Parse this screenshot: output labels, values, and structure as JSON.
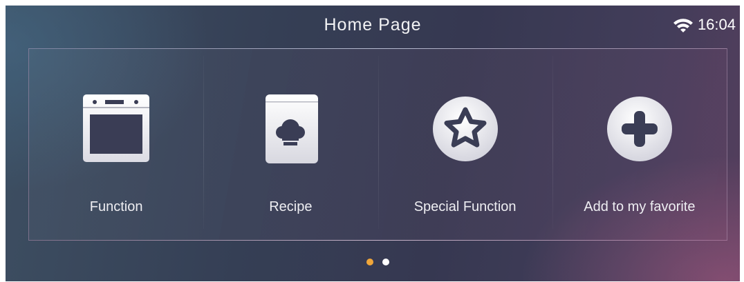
{
  "header": {
    "title": "Home Page",
    "time": "16:04",
    "wifi_icon": "wifi-icon"
  },
  "menu": {
    "items": [
      {
        "label": "Function",
        "icon": "oven-icon"
      },
      {
        "label": "Recipe",
        "icon": "recipe-book-icon"
      },
      {
        "label": "Special Function",
        "icon": "star-icon"
      },
      {
        "label": "Add to my favorite",
        "icon": "plus-icon"
      }
    ]
  },
  "pagination": {
    "pages": 2,
    "current": 1,
    "active_color": "#f0a63a",
    "inactive_color": "#ffffff"
  }
}
